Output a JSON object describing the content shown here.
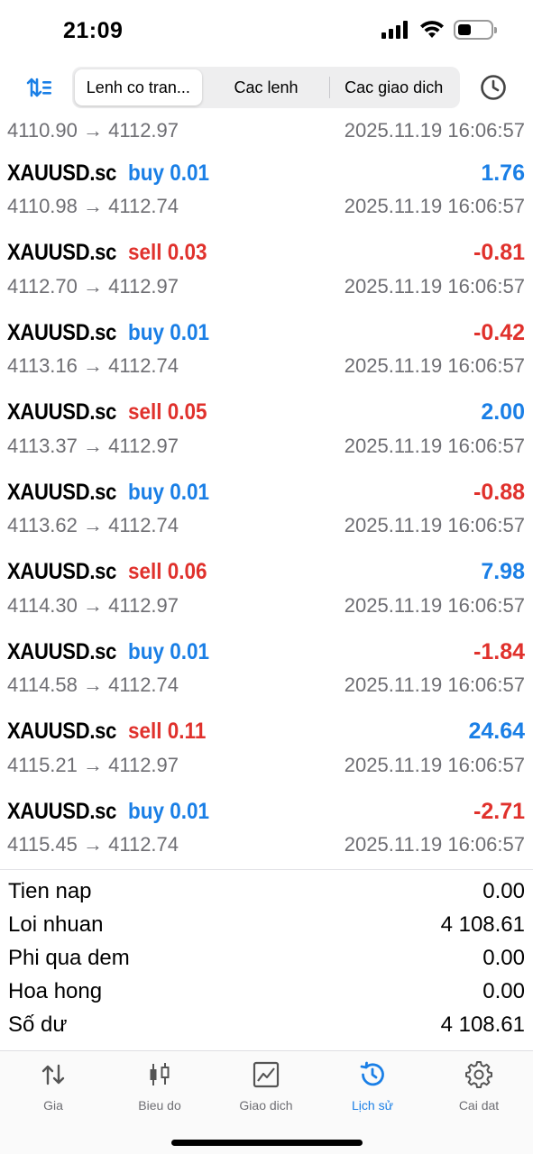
{
  "status": {
    "time": "21:09",
    "battery_level": 0.4
  },
  "toolbar": {
    "segments": [
      {
        "label": "Lenh co tran..."
      },
      {
        "label": "Cac lenh"
      },
      {
        "label": "Cac giao dich"
      }
    ],
    "active_segment": 0,
    "icons": {
      "left": "sort-icon",
      "right": "clock-history-icon"
    }
  },
  "partial_row": {
    "prices": "4110.90 → 4112.97",
    "time": "2025.11.19 16:06:57"
  },
  "trades": [
    {
      "symbol": "XAUUSD.sc",
      "side": "buy 0.01",
      "profit": "1.76",
      "prices": "4110.98 → 4112.74",
      "time": "2025.11.19 16:06:57"
    },
    {
      "symbol": "XAUUSD.sc",
      "side": "sell 0.03",
      "profit": "-0.81",
      "prices": "4112.70 → 4112.97",
      "time": "2025.11.19 16:06:57"
    },
    {
      "symbol": "XAUUSD.sc",
      "side": "buy 0.01",
      "profit": "-0.42",
      "prices": "4113.16 → 4112.74",
      "time": "2025.11.19 16:06:57"
    },
    {
      "symbol": "XAUUSD.sc",
      "side": "sell 0.05",
      "profit": "2.00",
      "prices": "4113.37 → 4112.97",
      "time": "2025.11.19 16:06:57"
    },
    {
      "symbol": "XAUUSD.sc",
      "side": "buy 0.01",
      "profit": "-0.88",
      "prices": "4113.62 → 4112.74",
      "time": "2025.11.19 16:06:57"
    },
    {
      "symbol": "XAUUSD.sc",
      "side": "sell 0.06",
      "profit": "7.98",
      "prices": "4114.30 → 4112.97",
      "time": "2025.11.19 16:06:57"
    },
    {
      "symbol": "XAUUSD.sc",
      "side": "buy 0.01",
      "profit": "-1.84",
      "prices": "4114.58 → 4112.74",
      "time": "2025.11.19 16:06:57"
    },
    {
      "symbol": "XAUUSD.sc",
      "side": "sell 0.11",
      "profit": "24.64",
      "prices": "4115.21 → 4112.97",
      "time": "2025.11.19 16:06:57"
    },
    {
      "symbol": "XAUUSD.sc",
      "side": "buy 0.01",
      "profit": "-2.71",
      "prices": "4115.45 → 4112.74",
      "time": "2025.11.19 16:06:57"
    }
  ],
  "summary": [
    {
      "label": "Tien nap",
      "value": "0.00"
    },
    {
      "label": "Loi nhuan",
      "value": "4 108.61"
    },
    {
      "label": "Phi qua dem",
      "value": "0.00"
    },
    {
      "label": "Hoa hong",
      "value": "0.00"
    },
    {
      "label": "Số dư",
      "value": "4 108.61"
    }
  ],
  "tabbar": {
    "tabs": [
      {
        "label": "Gia",
        "icon": "arrows-updown-icon"
      },
      {
        "label": "Bieu do",
        "icon": "candlestick-icon"
      },
      {
        "label": "Giao dich",
        "icon": "chart-line-icon"
      },
      {
        "label": "Lịch sử",
        "icon": "history-icon"
      },
      {
        "label": "Cai dat",
        "icon": "gear-icon"
      }
    ],
    "active_tab": 3
  },
  "colors": {
    "accent": "#1a7fe6",
    "negative": "#e0312c",
    "secondary_text": "#6e6e73"
  }
}
